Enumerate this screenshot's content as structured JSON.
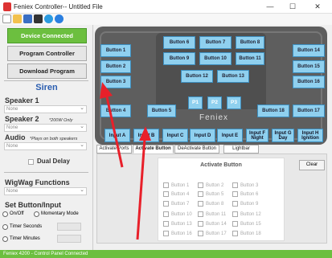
{
  "window": {
    "title": "Feniex Controller-- Untitled File",
    "minimize": "—",
    "maximize": "☐",
    "close": "✕"
  },
  "left": {
    "device_connected": "Device Connected",
    "program_controller": "Program Controller",
    "download_program": "Download Program",
    "siren_title": "Siren",
    "speaker1_label": "Speaker 1",
    "speaker1_value": "None",
    "speaker2_label": "Speaker 2",
    "speaker2_note": "*200W Only",
    "speaker2_value": "None",
    "audio_label": "Audio",
    "audio_note": "*Plays on both speakers",
    "audio_value": "None",
    "dual_delay": "Dual Delay",
    "wigwag_title": "WigWag Functions",
    "wigwag_value": "None",
    "setbutton_title": "Set Button/Input",
    "radio_onoff": "On/Off",
    "radio_momentary": "Momentary Mode",
    "radio_timer_seconds": "Timer Seconds",
    "radio_timer_minutes": "Timer Minutes"
  },
  "console": {
    "buttons": {
      "b1": "Button 1",
      "b2": "Button 2",
      "b3": "Button 3",
      "b4": "Button 4",
      "b5": "Button 5",
      "b6": "Button 6",
      "b7": "Button 7",
      "b8": "Button 8",
      "b9": "Button 9",
      "b10": "Button 10",
      "b11": "Button 11",
      "b12": "Button 12",
      "b13": "Button 13",
      "b14": "Button 14",
      "b15": "Button 15",
      "b16": "Button 16",
      "b17": "Button 17",
      "b18": "Button 18"
    },
    "p1": "P1",
    "p2": "P2",
    "p3": "P3",
    "brand": "Feniex"
  },
  "inputs": {
    "a": "Input A",
    "b": "Input B",
    "c": "Input C",
    "d": "Input D",
    "e": "Input E",
    "f": "Input F Night",
    "g": "Input G Day",
    "h": "Input H Ignition"
  },
  "tabs": {
    "activate_ports": "Activate Ports",
    "activate_button": "Activate Button",
    "deactivate_button": "DeActivate Button",
    "lightbar": "Lightbar"
  },
  "panel": {
    "title": "Activate Button",
    "clear": "Clear",
    "rows": [
      [
        "Button 1",
        "Button 2",
        "Button 3"
      ],
      [
        "Button 4",
        "Button 5",
        "Button 6"
      ],
      [
        "Button 7",
        "Button 8",
        "Button 9"
      ],
      [
        "Button 10",
        "Button 11",
        "Button 12"
      ],
      [
        "Button 13",
        "Button 14",
        "Button 15"
      ],
      [
        "Button 16",
        "Button 17",
        "Button 18"
      ]
    ]
  },
  "status": "Feniex 4200 - Control Panel Connected",
  "colors": {
    "accent_green": "#6cbf3f",
    "button_blue": "#8fd0ef",
    "console_gray": "#5e5e5e",
    "arrow_red": "#e8202a"
  }
}
